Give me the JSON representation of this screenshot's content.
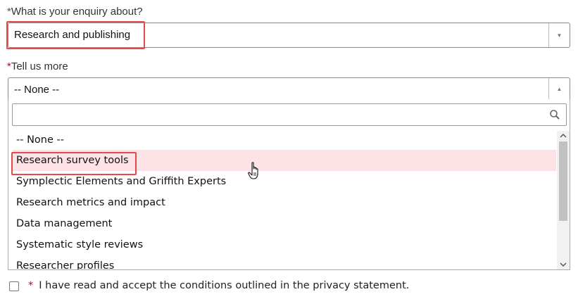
{
  "enquiry": {
    "required_mark": "*",
    "label": "What is your enquiry about?",
    "value": "Research and publishing"
  },
  "tell_more": {
    "required_mark": "*",
    "label": "Tell us more",
    "value": "-- None --",
    "search_placeholder": ""
  },
  "options": [
    "-- None --",
    "Research survey tools",
    "Symplectic Elements and Griffith Experts",
    "Research metrics and impact",
    "Data management",
    "Systematic style reviews",
    "Researcher profiles"
  ],
  "hovered_option_index": 1,
  "privacy": {
    "required_mark": "*",
    "label": "I have read and accept the conditions outlined in the privacy statement."
  },
  "colors": {
    "highlight_border": "#e14b4b",
    "hover_bg": "#fde3e5",
    "required": "#d0021b"
  }
}
